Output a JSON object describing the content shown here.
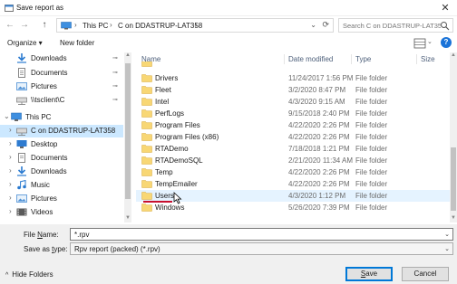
{
  "window": {
    "title": "Save report as",
    "close_glyph": "✕"
  },
  "address": {
    "back_glyph": "←",
    "forward_glyph": "→",
    "up_glyph": "↑",
    "crumbs": [
      "This PC",
      "C on DDASTRUP-LAT358"
    ],
    "separator": "›",
    "dropdown_glyph": "⌄",
    "refresh_glyph": "⟳"
  },
  "search": {
    "placeholder": "Search C on DDASTRUP-LAT358"
  },
  "toolbar": {
    "organize_label": "Organize ▾",
    "new_folder_label": "New folder",
    "help_label": "?"
  },
  "nav": {
    "items": [
      {
        "label": "Downloads",
        "icon": "download-arrow-icon",
        "pinned": true
      },
      {
        "label": "Documents",
        "icon": "document-icon",
        "pinned": true
      },
      {
        "label": "Pictures",
        "icon": "picture-icon",
        "pinned": true
      },
      {
        "label": "\\\\tsclient\\C",
        "icon": "network-drive-icon",
        "pinned": true
      },
      {
        "label": "This PC",
        "icon": "computer-icon",
        "pinned": false
      },
      {
        "label": "C on DDASTRUP-LAT358",
        "icon": "network-drive-icon",
        "pinned": false
      },
      {
        "label": "Desktop",
        "icon": "desktop-icon",
        "pinned": false
      },
      {
        "label": "Documents",
        "icon": "document-icon",
        "pinned": false
      },
      {
        "label": "Downloads",
        "icon": "download-arrow-icon",
        "pinned": false
      },
      {
        "label": "Music",
        "icon": "music-icon",
        "pinned": false
      },
      {
        "label": "Pictures",
        "icon": "picture-icon",
        "pinned": false
      },
      {
        "label": "Videos",
        "icon": "video-icon",
        "pinned": false
      }
    ],
    "pin_glyph": "📌",
    "expand_glyph": "›"
  },
  "columns": {
    "name": "Name",
    "date": "Date modified",
    "type": "Type",
    "size": "Size",
    "sort_glyph": "^"
  },
  "files": [
    {
      "name": "Drivers",
      "date": "11/24/2017 1:56 PM",
      "type": "File folder"
    },
    {
      "name": "Fleet",
      "date": "3/2/2020 8:47 PM",
      "type": "File folder"
    },
    {
      "name": "Intel",
      "date": "4/3/2020 9:15 AM",
      "type": "File folder"
    },
    {
      "name": "PerfLogs",
      "date": "9/15/2018 2:40 PM",
      "type": "File folder"
    },
    {
      "name": "Program Files",
      "date": "4/22/2020 2:26 PM",
      "type": "File folder"
    },
    {
      "name": "Program Files (x86)",
      "date": "4/22/2020 2:26 PM",
      "type": "File folder"
    },
    {
      "name": "RTADemo",
      "date": "7/18/2018 1:21 PM",
      "type": "File folder"
    },
    {
      "name": "RTADemoSQL",
      "date": "2/21/2020 11:34 AM",
      "type": "File folder"
    },
    {
      "name": "Temp",
      "date": "4/22/2020 2:26 PM",
      "type": "File folder"
    },
    {
      "name": "TempEmailer",
      "date": "4/22/2020 2:26 PM",
      "type": "File folder"
    },
    {
      "name": "Users",
      "date": "4/3/2020 1:12 PM",
      "type": "File folder"
    },
    {
      "name": "Windows",
      "date": "5/26/2020 7:39 PM",
      "type": "File folder"
    }
  ],
  "form": {
    "file_name_label_u": "N",
    "file_name_label_pre": "File ",
    "file_name_label_post": "ame:",
    "file_name_value": "*.rpv",
    "save_type_label_pre": "Save as ",
    "save_type_label_u": "t",
    "save_type_label_post": "ype:",
    "save_type_value": "Rpv report (packed) (*.rpv)",
    "dropdown_glyph": "⌄"
  },
  "footer": {
    "hide_folders_label": "Hide Folders",
    "caret_glyph": "^",
    "save_label_u": "S",
    "save_label_rest": "ave",
    "cancel_label": "Cancel"
  },
  "colors": {
    "accent": "#0078d7",
    "selection": "#cce8ff",
    "hover": "#e5f3ff",
    "folder": "#f8d775",
    "annotation": "#c8102e"
  }
}
